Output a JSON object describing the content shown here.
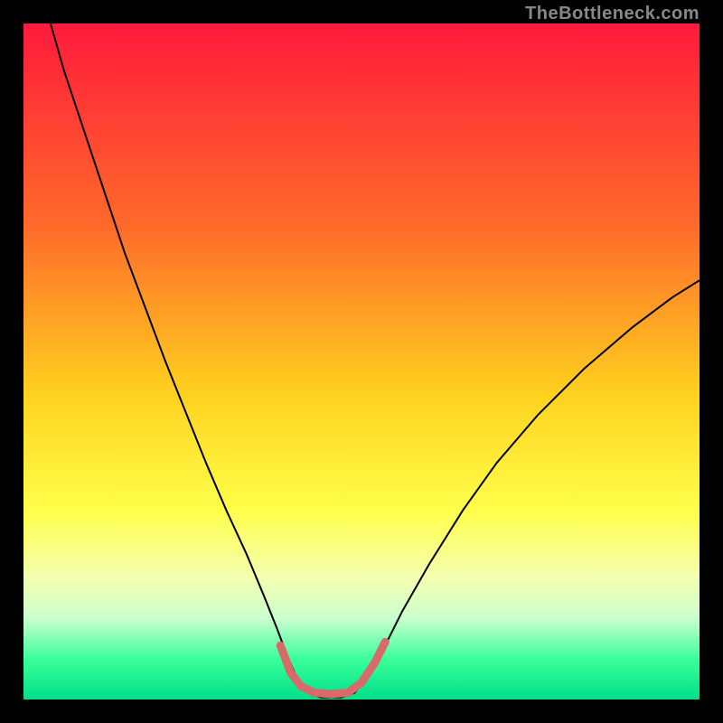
{
  "watermark": "TheBottleneck.com",
  "chart_data": {
    "type": "line",
    "title": "",
    "xlabel": "",
    "ylabel": "",
    "xlim": [
      0,
      100
    ],
    "ylim": [
      0,
      100
    ],
    "gradient_stops": [
      {
        "pos": 0,
        "color": "#ff1a3c"
      },
      {
        "pos": 30,
        "color": "#ff6a2a"
      },
      {
        "pos": 55,
        "color": "#ffd21f"
      },
      {
        "pos": 72,
        "color": "#ffff4a"
      },
      {
        "pos": 82,
        "color": "#f4ffb0"
      },
      {
        "pos": 88,
        "color": "#caffcf"
      },
      {
        "pos": 94,
        "color": "#3aff9a"
      },
      {
        "pos": 100,
        "color": "#00e08a"
      }
    ],
    "series": [
      {
        "name": "bottleneck-curve",
        "color": "#000000",
        "width": 2,
        "points": [
          {
            "x": 4.0,
            "y": 100.0
          },
          {
            "x": 6.0,
            "y": 93.0
          },
          {
            "x": 9.0,
            "y": 84.0
          },
          {
            "x": 12.0,
            "y": 75.0
          },
          {
            "x": 15.0,
            "y": 66.0
          },
          {
            "x": 18.0,
            "y": 58.0
          },
          {
            "x": 21.0,
            "y": 50.0
          },
          {
            "x": 24.0,
            "y": 42.5
          },
          {
            "x": 27.0,
            "y": 35.0
          },
          {
            "x": 30.0,
            "y": 28.0
          },
          {
            "x": 33.0,
            "y": 21.5
          },
          {
            "x": 35.5,
            "y": 15.5
          },
          {
            "x": 37.5,
            "y": 10.5
          },
          {
            "x": 39.0,
            "y": 6.5
          },
          {
            "x": 40.5,
            "y": 3.0
          },
          {
            "x": 42.0,
            "y": 1.0
          },
          {
            "x": 44.0,
            "y": 0.3
          },
          {
            "x": 47.0,
            "y": 0.3
          },
          {
            "x": 49.0,
            "y": 1.0
          },
          {
            "x": 51.0,
            "y": 3.5
          },
          {
            "x": 53.0,
            "y": 7.0
          },
          {
            "x": 56.0,
            "y": 13.0
          },
          {
            "x": 60.0,
            "y": 20.0
          },
          {
            "x": 65.0,
            "y": 28.0
          },
          {
            "x": 70.0,
            "y": 35.0
          },
          {
            "x": 76.0,
            "y": 42.0
          },
          {
            "x": 83.0,
            "y": 49.0
          },
          {
            "x": 90.0,
            "y": 55.0
          },
          {
            "x": 96.0,
            "y": 59.5
          },
          {
            "x": 100.0,
            "y": 62.0
          }
        ]
      },
      {
        "name": "optimal-zone",
        "color": "#d86a6a",
        "width": 9,
        "linecap": "round",
        "points": [
          {
            "x": 38.0,
            "y": 8.0
          },
          {
            "x": 39.5,
            "y": 4.0
          },
          {
            "x": 41.0,
            "y": 2.0
          },
          {
            "x": 43.0,
            "y": 1.0
          },
          {
            "x": 45.5,
            "y": 0.8
          },
          {
            "x": 48.0,
            "y": 1.0
          },
          {
            "x": 50.0,
            "y": 2.5
          },
          {
            "x": 52.0,
            "y": 5.5
          },
          {
            "x": 53.5,
            "y": 8.5
          }
        ]
      }
    ]
  }
}
